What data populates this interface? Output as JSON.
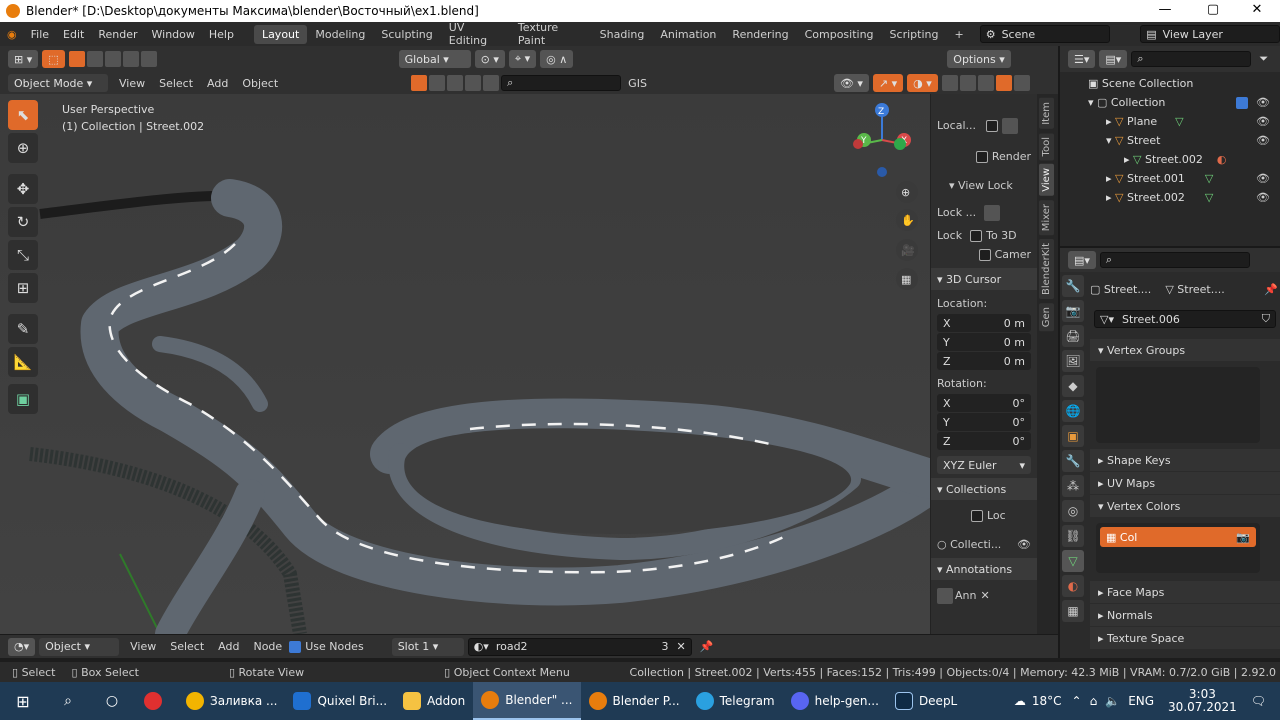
{
  "window": {
    "title": "Blender* [D:\\Desktop\\документы Максима\\blender\\Восточный\\ex1.blend]",
    "min": "—",
    "max": "▢",
    "close": "✕"
  },
  "menus": [
    "File",
    "Edit",
    "Render",
    "Window",
    "Help"
  ],
  "workspaces": [
    "Layout",
    "Modeling",
    "Sculpting",
    "UV Editing",
    "Texture Paint",
    "Shading",
    "Animation",
    "Rendering",
    "Compositing",
    "Scripting"
  ],
  "active_workspace": "Layout",
  "scene": "Scene",
  "view_layer": "View Layer",
  "toolbar": {
    "transform": "Global",
    "options": "Options",
    "gis": "GIS"
  },
  "viewport_header": {
    "mode": "Object Mode",
    "items": [
      "View",
      "Select",
      "Add",
      "Object"
    ]
  },
  "overlay_text": {
    "perspective": "User Perspective",
    "collection": "(1) Collection | Street.002"
  },
  "gizmo": {
    "x": "X",
    "y": "Y",
    "z": "Z"
  },
  "npanel": {
    "local": "Local...",
    "render": "Render",
    "view_lock": "View Lock",
    "lock_obj": "Lock ...",
    "lock": "Lock",
    "to3d": "To 3D",
    "camera": "Camer",
    "cursor_head": "3D Cursor",
    "location": "Location:",
    "loc": [
      {
        "axis": "X",
        "val": "0 m"
      },
      {
        "axis": "Y",
        "val": "0 m"
      },
      {
        "axis": "Z",
        "val": "0 m"
      }
    ],
    "rotation": "Rotation:",
    "rot": [
      {
        "axis": "X",
        "val": "0°"
      },
      {
        "axis": "Y",
        "val": "0°"
      },
      {
        "axis": "Z",
        "val": "0°"
      }
    ],
    "euler": "XYZ Euler",
    "collections_head": "Collections",
    "loc_cb": "Loc",
    "collecti": "Collecti...",
    "annotations_head": "Annotations",
    "ann": "Ann"
  },
  "ntabs": [
    "Item",
    "Tool",
    "View",
    "Mixer",
    "BlenderKit",
    "Gen"
  ],
  "outliner": {
    "root": "Scene Collection",
    "rows": [
      {
        "label": "Collection",
        "indent": 1
      },
      {
        "label": "Plane",
        "indent": 2
      },
      {
        "label": "Street",
        "indent": 2
      },
      {
        "label": "Street.002",
        "indent": 3
      },
      {
        "label": "Street.001",
        "indent": 2
      },
      {
        "label": "Street.002",
        "indent": 2
      }
    ]
  },
  "props": {
    "crumb1": "Street....",
    "crumb2": "Street....",
    "mesh": "Street.006",
    "sections": [
      "Vertex Groups",
      "Shape Keys",
      "UV Maps",
      "Vertex Colors",
      "Face Maps",
      "Normals",
      "Texture Space"
    ],
    "vc_item": "Col"
  },
  "timeline": {
    "mode": "Object",
    "items": [
      "View",
      "Select",
      "Add",
      "Node"
    ],
    "use_nodes": "Use Nodes",
    "slot": "Slot 1",
    "material": "road2",
    "users": "3"
  },
  "status": {
    "select": "Select",
    "box": "Box Select",
    "rotate": "Rotate View",
    "context": "Object Context Menu",
    "info": "Collection | Street.002 | Verts:455 | Faces:152 | Tris:499 | Objects:0/4 | Memory: 42.3 MiB | VRAM: 0.7/2.0 GiB | 2.92.0"
  },
  "taskbar": {
    "tasks": [
      {
        "label": "Заливка ...",
        "color": "#f2b400"
      },
      {
        "label": "Quixel Bri...",
        "color": "#1f6fd0"
      },
      {
        "label": "Addon",
        "color": "#f5c242"
      },
      {
        "label": "Blender\" ...",
        "color": "#e87d0d"
      },
      {
        "label": "Blender P...",
        "color": "#e87d0d"
      },
      {
        "label": "Telegram",
        "color": "#2aa0e0"
      },
      {
        "label": "help-gen...",
        "color": "#5865f2"
      },
      {
        "label": "DeepL",
        "color": "#0f2b46"
      }
    ],
    "weather": "18°C",
    "lang": "ENG",
    "time": "3:03",
    "date": "30.07.2021"
  },
  "colors": {
    "accent": "#e06a2a",
    "select": "#334d80"
  }
}
